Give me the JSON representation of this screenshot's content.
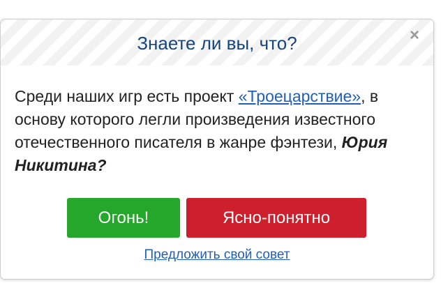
{
  "dialog": {
    "title": "Знаете ли вы, что?",
    "close_symbol": "×",
    "message": {
      "text_before": "Среди наших игр есть проект ",
      "link_text": "«Троецарствие»",
      "text_middle": ", в основу которого легли произведения известного отечественного писателя в жанре фэнтези, ",
      "emphasis_text": "Юрия Никитина?"
    },
    "buttons": {
      "confirm_label": "Огонь!",
      "dismiss_label": "Ясно-понятно"
    },
    "suggest_link": "Предложить свой совет",
    "colors": {
      "title": "#16447c",
      "link": "#1f5fb7",
      "confirm_button": "#24a72b",
      "dismiss_button": "#cd1f2c"
    }
  }
}
